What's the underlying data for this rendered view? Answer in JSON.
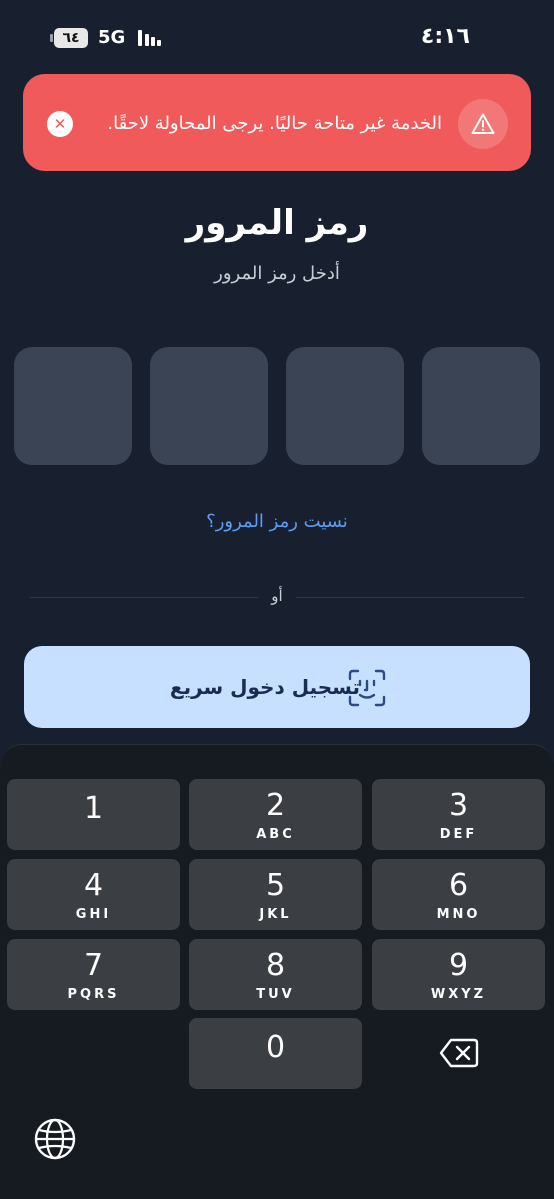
{
  "status_bar": {
    "battery": "٦٤",
    "network": "5G",
    "time": "٤:١٦"
  },
  "error_banner": {
    "message": "الخدمة غير متاحة حاليًا. يرجى المحاولة لاحقًا.",
    "close_icon": "close-icon",
    "warning_icon": "warning-icon",
    "background_color": "#f05a5a"
  },
  "page": {
    "title": "رمز المرور",
    "subtitle": "أدخل رمز المرور",
    "pin_length": 4,
    "forgot_link": "نسيت رمز المرور؟",
    "or_label": "أو",
    "quick_login_label": "تسجيل دخول سريع",
    "quick_login_icon": "face-id-icon"
  },
  "keypad": {
    "keys": [
      {
        "digit": "1",
        "letters": ""
      },
      {
        "digit": "2",
        "letters": "ABC"
      },
      {
        "digit": "3",
        "letters": "DEF"
      },
      {
        "digit": "4",
        "letters": "GHI"
      },
      {
        "digit": "5",
        "letters": "JKL"
      },
      {
        "digit": "6",
        "letters": "MNO"
      },
      {
        "digit": "7",
        "letters": "PQRS"
      },
      {
        "digit": "8",
        "letters": "TUV"
      },
      {
        "digit": "9",
        "letters": "WXYZ"
      },
      {
        "digit": "0",
        "letters": ""
      }
    ],
    "backspace_icon": "backspace-icon",
    "globe_icon": "globe-icon"
  },
  "colors": {
    "background": "#182030",
    "pin_box": "#3a4454",
    "link": "#5a9ef5",
    "quick_login_bg": "#c8e0ff",
    "key_bg": "#3b3e43",
    "keyboard_bg": "#161b22"
  }
}
